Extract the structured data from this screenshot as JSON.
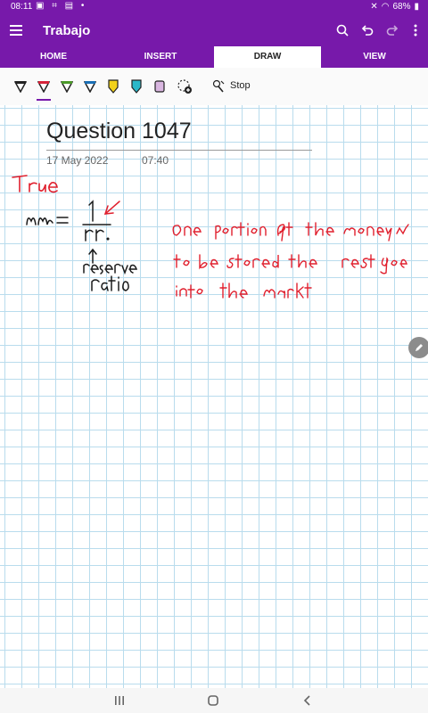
{
  "status_bar": {
    "time": "08:11",
    "battery": "68%"
  },
  "app": {
    "title": "Trabajo"
  },
  "tabs": [
    {
      "label": "HOME"
    },
    {
      "label": "INSERT"
    },
    {
      "label": "DRAW"
    },
    {
      "label": "VIEW"
    }
  ],
  "draw_toolbar": {
    "pen_colors": [
      "#222222",
      "#d6243a",
      "#4c9a2a",
      "#1a6fb5",
      "#f2d21b",
      "#2bb8c9",
      "#d9b6e0"
    ],
    "stop_label": "Stop"
  },
  "page": {
    "title": "Question 1047",
    "date": "17 May 2022",
    "time": "07:40"
  },
  "colors": {
    "brand": "#7719aa",
    "grid": "#b9dced",
    "ink_red": "#e0202e",
    "ink_black": "#1a1a1a"
  }
}
